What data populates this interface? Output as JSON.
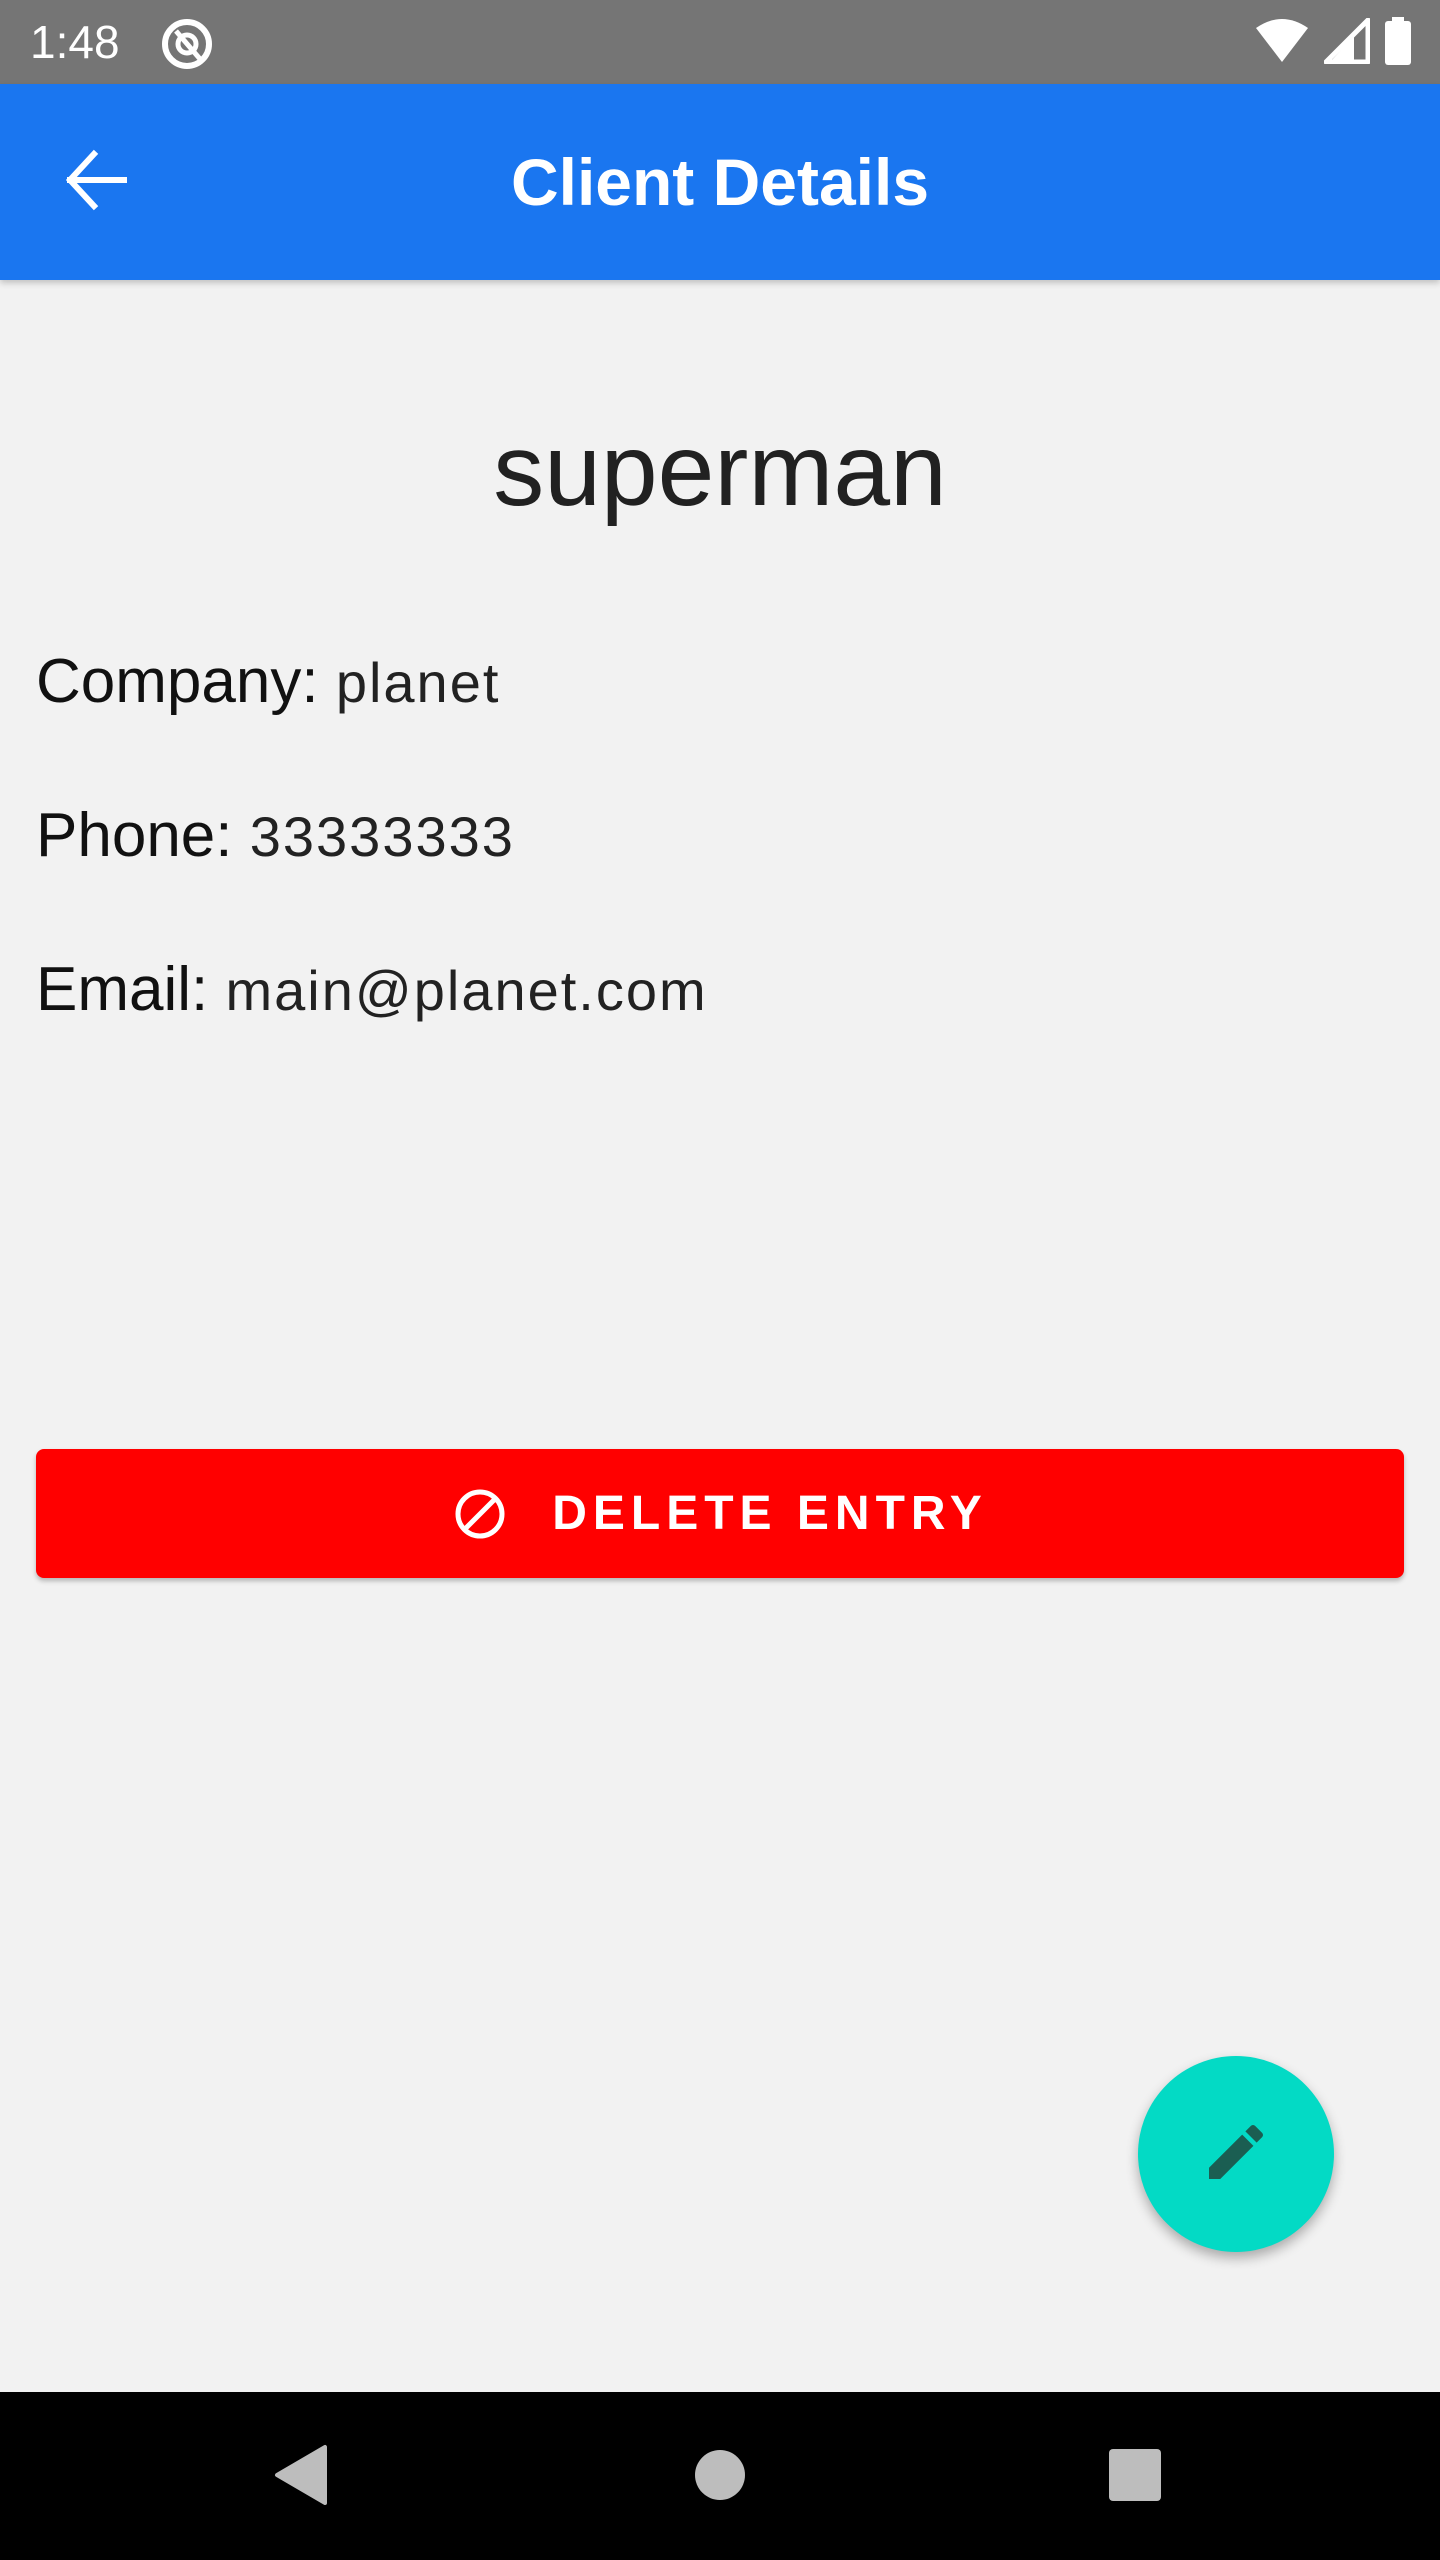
{
  "status_bar": {
    "time": "1:48",
    "icons": [
      "app-notification-icon",
      "wifi-icon",
      "signal-icon",
      "battery-icon"
    ]
  },
  "app_bar": {
    "title": "Client Details",
    "back_icon": "arrow-back-icon",
    "background_color": "#1a76f0"
  },
  "client": {
    "name": "superman",
    "fields": {
      "company": {
        "label": "Company:",
        "value": "planet"
      },
      "phone": {
        "label": "Phone:",
        "value": "33333333"
      },
      "email": {
        "label": "Email:",
        "value": "main@planet.com"
      }
    }
  },
  "delete_button": {
    "label": "DELETE ENTRY",
    "icon": "block-icon",
    "color": "#ff0000"
  },
  "fab": {
    "icon": "pencil-icon",
    "color": "#03dac5"
  },
  "nav_bar": {
    "buttons": [
      "nav-back-icon",
      "nav-home-icon",
      "nav-recents-icon"
    ]
  }
}
